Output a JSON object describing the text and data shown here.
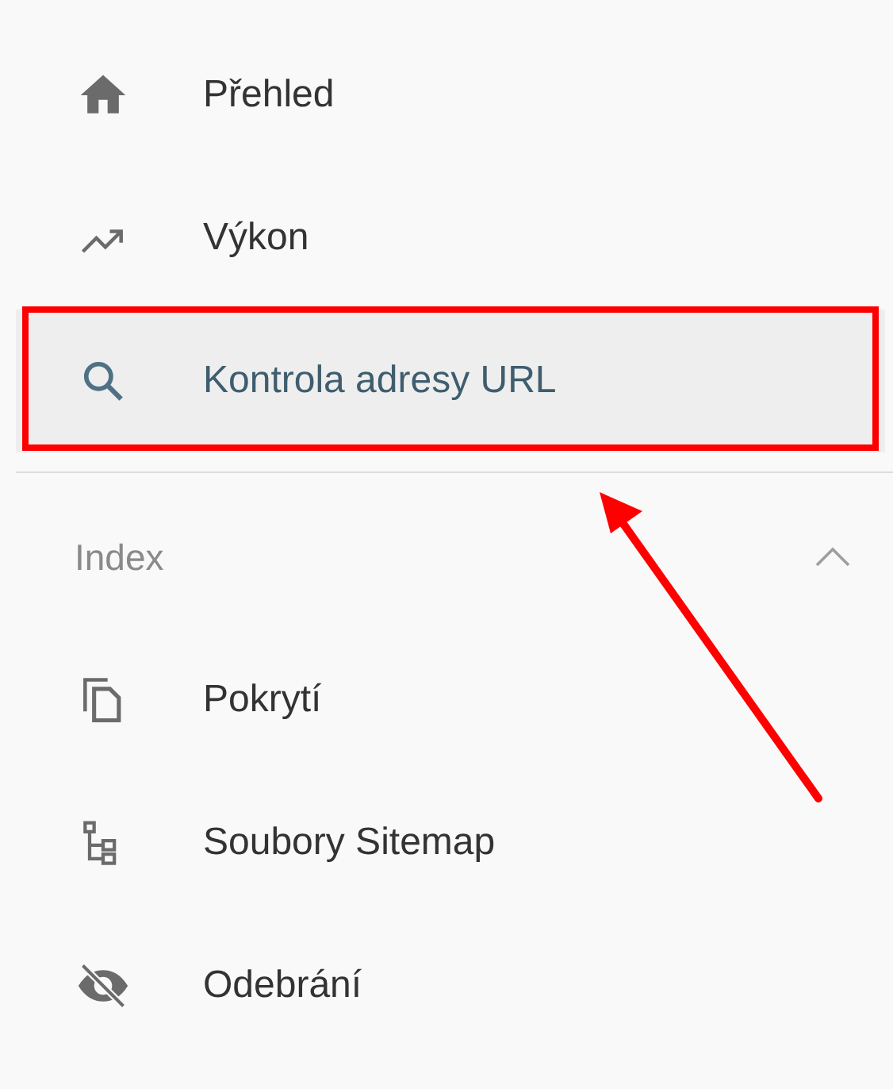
{
  "nav_items": [
    {
      "label": "Přehled",
      "kind": "home",
      "selected": false
    },
    {
      "label": "Výkon",
      "kind": "trend",
      "selected": false
    },
    {
      "label": "Kontrola adresy URL",
      "kind": "search",
      "selected": true
    }
  ],
  "section": {
    "title": "Index",
    "expanded": true,
    "items": [
      {
        "label": "Pokrytí",
        "kind": "copy",
        "selected": false
      },
      {
        "label": "Soubory Sitemap",
        "kind": "sitemap",
        "selected": false
      },
      {
        "label": "Odebrání",
        "kind": "eye-off",
        "selected": false
      }
    ]
  },
  "annotation": {
    "highlight_box": true,
    "arrow": true
  }
}
